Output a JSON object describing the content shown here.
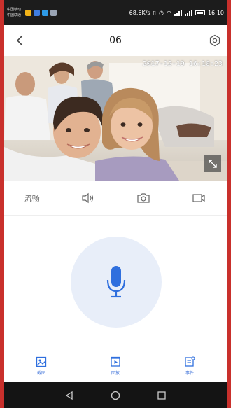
{
  "status_bar": {
    "carrier_top": "中国移动",
    "carrier_bottom": "中国联通",
    "speed": "68.6K/s",
    "time": "16:10"
  },
  "header": {
    "title": "06",
    "back_icon": "back-chevron-icon",
    "settings_icon": "gear-icon"
  },
  "video": {
    "timestamp": "2017-12-19 16:10:23"
  },
  "controls": {
    "quality_label": "流畅",
    "items": [
      "quality",
      "speaker-icon",
      "camera-icon",
      "record-icon"
    ]
  },
  "talk": {
    "mic_icon": "microphone-icon"
  },
  "bottom_nav": {
    "items": [
      {
        "label": "截图",
        "icon": "gallery-icon"
      },
      {
        "label": "回放",
        "icon": "playback-icon"
      },
      {
        "label": "事件",
        "icon": "event-list-icon"
      }
    ]
  },
  "colors": {
    "accent": "#2f6fde",
    "mic_circle": "#e8eef9",
    "frame_border": "#c9302c"
  }
}
